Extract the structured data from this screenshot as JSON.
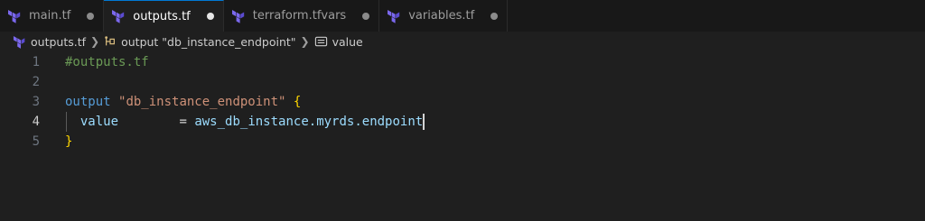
{
  "tabs": [
    {
      "label": "main.tf",
      "active": false,
      "dirty": true
    },
    {
      "label": "outputs.tf",
      "active": true,
      "dirty": true
    },
    {
      "label": "terraform.tfvars",
      "active": false,
      "dirty": true
    },
    {
      "label": "variables.tf",
      "active": false,
      "dirty": true
    }
  ],
  "breadcrumb": {
    "file": "outputs.tf",
    "block": "output \"db_instance_endpoint\"",
    "property": "value"
  },
  "editor": {
    "current_line": 4,
    "lines": [
      {
        "number": "1",
        "comment": "#outputs.tf"
      },
      {
        "number": "2"
      },
      {
        "number": "3",
        "keyword": "output",
        "string": "\"db_instance_endpoint\"",
        "brace": "{"
      },
      {
        "number": "4",
        "attr": "value",
        "op": "=",
        "ref": "aws_db_instance.myrds.endpoint"
      },
      {
        "number": "5",
        "brace": "}"
      }
    ]
  },
  "colors": {
    "accent": "#0078d4",
    "terraform_icon": "#7b68ee",
    "comment": "#6a9955",
    "keyword": "#569cd6",
    "string": "#ce9178",
    "brace": "#ffd700"
  }
}
